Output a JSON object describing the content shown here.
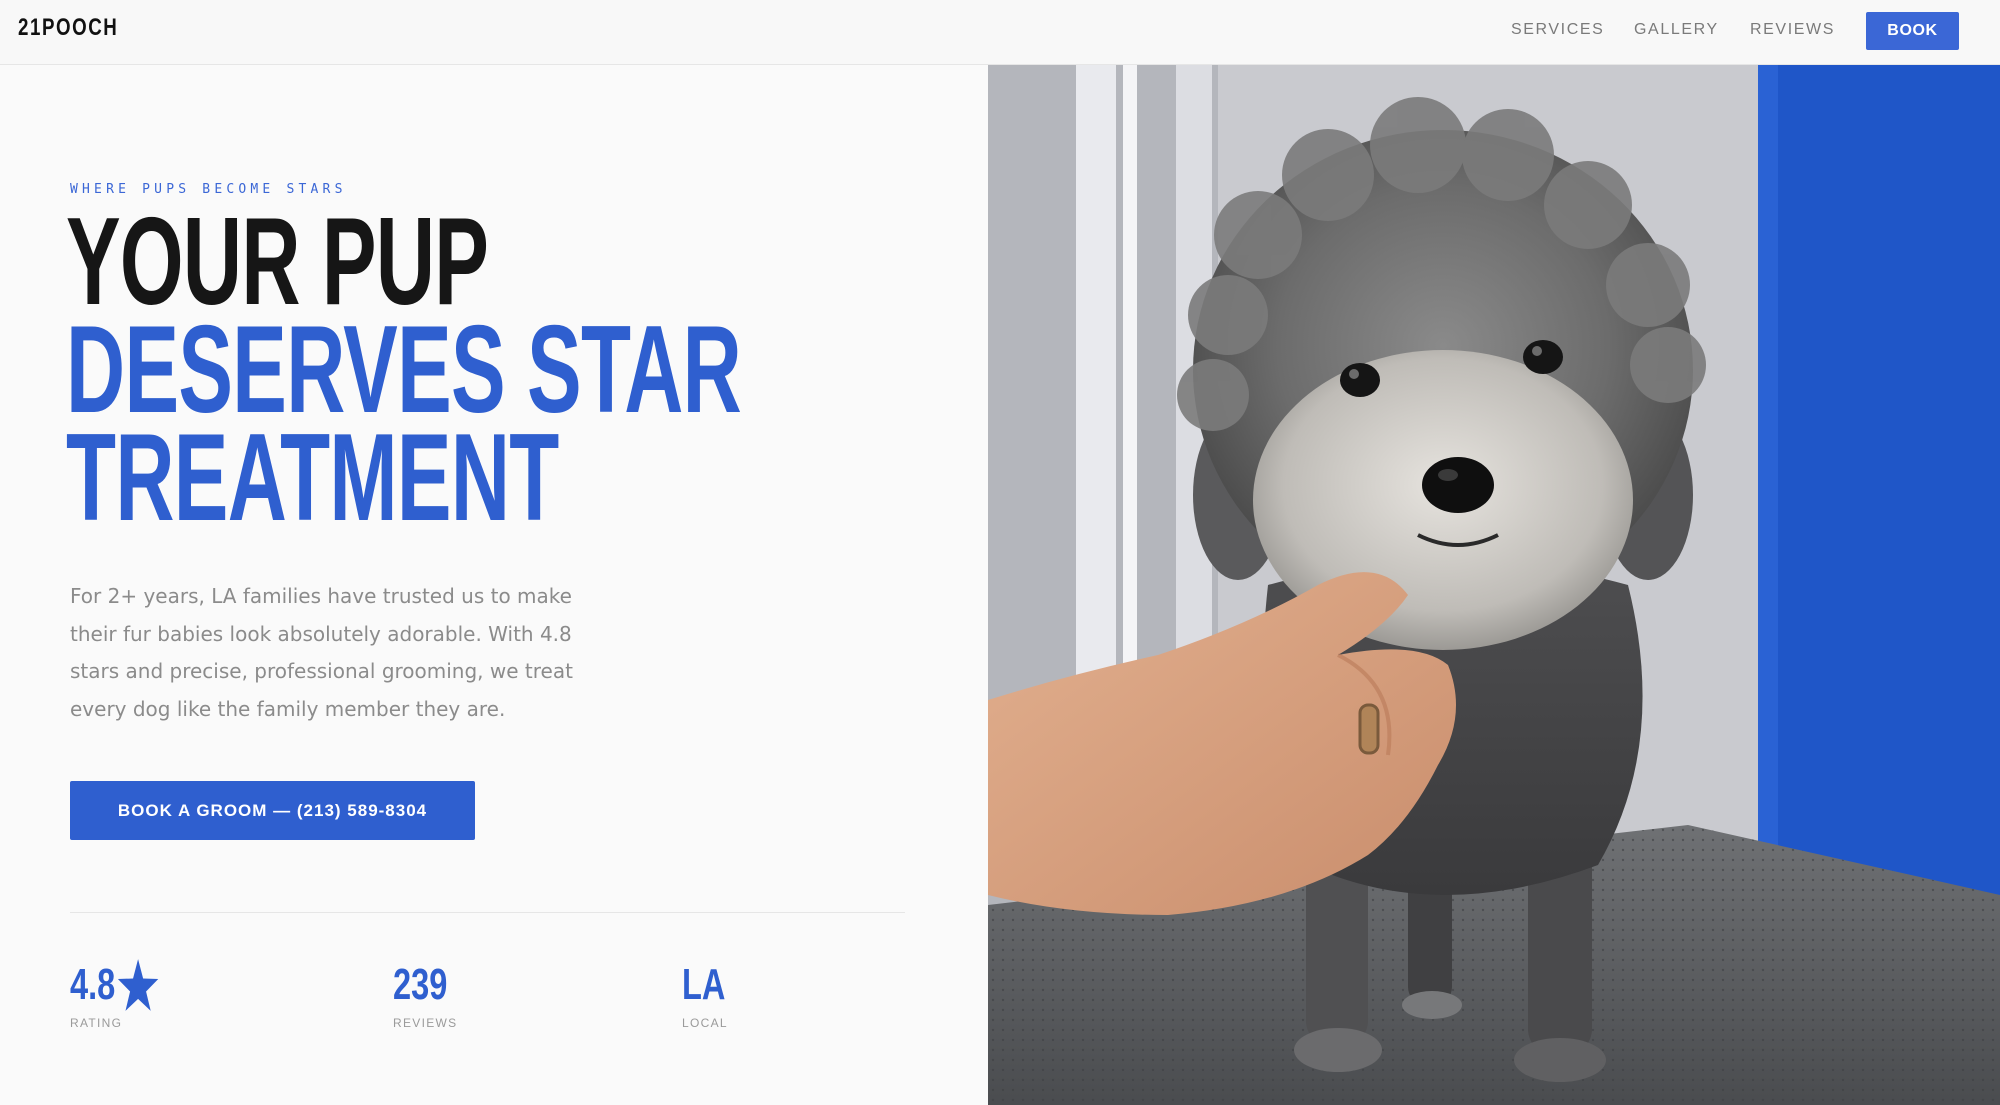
{
  "nav": {
    "logo": "21POOCH",
    "links": [
      {
        "label": "SERVICES"
      },
      {
        "label": "GALLERY"
      },
      {
        "label": "REVIEWS"
      }
    ],
    "book_label": "BOOK"
  },
  "hero": {
    "eyebrow": "WHERE PUPS BECOME STARS",
    "headline": {
      "line1": "YOUR PUP",
      "line2": "DESERVES STAR",
      "line3": "TREATMENT"
    },
    "lede": "For 2+ years, LA families have trusted us to make their fur babies look absolutely adorable. With 4.8 stars and precise, professional grooming, we treat every dog like the family member they are.",
    "cta_label": "BOOK A GROOM — (213) 589-8304",
    "image_icon": "groomed-poodle-photo"
  },
  "stats": [
    {
      "value": "4.8",
      "icon": "star-icon",
      "label": "RATING"
    },
    {
      "value": "239",
      "label": "REVIEWS"
    },
    {
      "value": "LA",
      "label": "LOCAL"
    }
  ],
  "colors": {
    "accent": "#2f5fcf",
    "button": "#3b67d6",
    "background": "#fafafa",
    "text_dark": "#161616",
    "text_muted": "#8b8b8b"
  }
}
